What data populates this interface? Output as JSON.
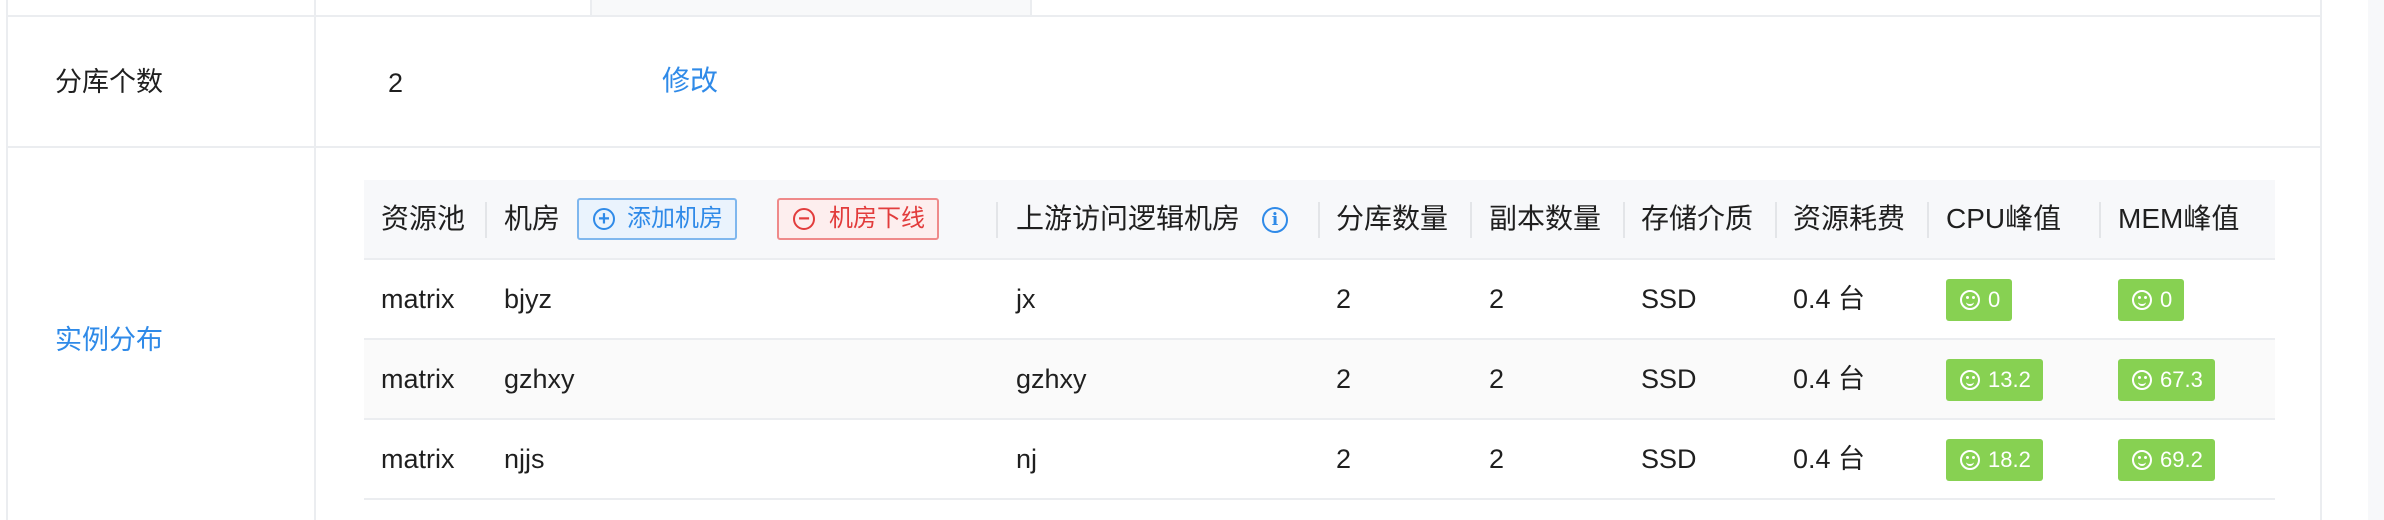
{
  "form": {
    "shard_count": {
      "label": "分库个数",
      "value": "2",
      "edit_link": "修改"
    },
    "instance_distribution": {
      "label": "实例分布"
    }
  },
  "table": {
    "headers": {
      "pool": "资源池",
      "idc": "机房",
      "add_idc": "添加机房",
      "offline_idc": "机房下线",
      "upstream": "上游访问逻辑机房",
      "shards": "分库数量",
      "replicas": "副本数量",
      "storage": "存储介质",
      "cost": "资源耗费",
      "cpu": "CPU峰值",
      "mem": "MEM峰值"
    },
    "rows": [
      {
        "pool": "matrix",
        "idc": "bjyz",
        "upstream": "jx",
        "shards": "2",
        "replicas": "2",
        "storage": "SSD",
        "cost": "0.4 台",
        "cpu": "0",
        "mem": "0"
      },
      {
        "pool": "matrix",
        "idc": "gzhxy",
        "upstream": "gzhxy",
        "shards": "2",
        "replicas": "2",
        "storage": "SSD",
        "cost": "0.4 台",
        "cpu": "13.2",
        "mem": "67.3"
      },
      {
        "pool": "matrix",
        "idc": "njjs",
        "upstream": "nj",
        "shards": "2",
        "replicas": "2",
        "storage": "SSD",
        "cost": "0.4 台",
        "cpu": "18.2",
        "mem": "69.2"
      }
    ]
  },
  "icons": {
    "add": "plus-circle-icon",
    "remove": "minus-circle-icon",
    "info": "info-circle-icon",
    "smile": "smile-icon"
  },
  "colors": {
    "accent": "#2f8ae8",
    "danger": "#e23c3c",
    "badge_green": "#87d152"
  }
}
